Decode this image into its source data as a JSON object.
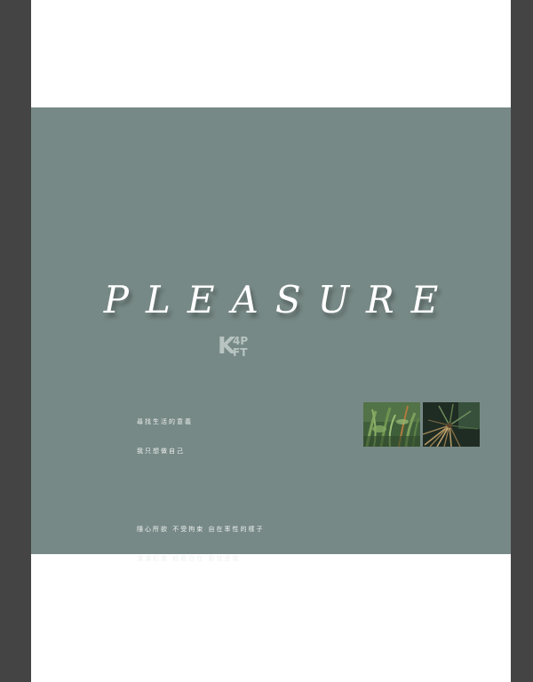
{
  "title": "PLEASURE",
  "logo": {
    "letter": "K",
    "top": "4P",
    "bottom": "FT"
  },
  "lines": {
    "p1": [
      "尋找生活的意義",
      "我只想做自己"
    ],
    "p2": [
      "隨心所欲 不受拘束 自在率性的樣子",
      "瀟灑紅塵 輕鬆自在 那就是我"
    ]
  },
  "colors": {
    "background": "#444444",
    "page": "#ffffff",
    "band": "#778986",
    "title": "#ffffff"
  },
  "photos": [
    {
      "subject": "green-plants"
    },
    {
      "subject": "palm-fronds"
    }
  ]
}
